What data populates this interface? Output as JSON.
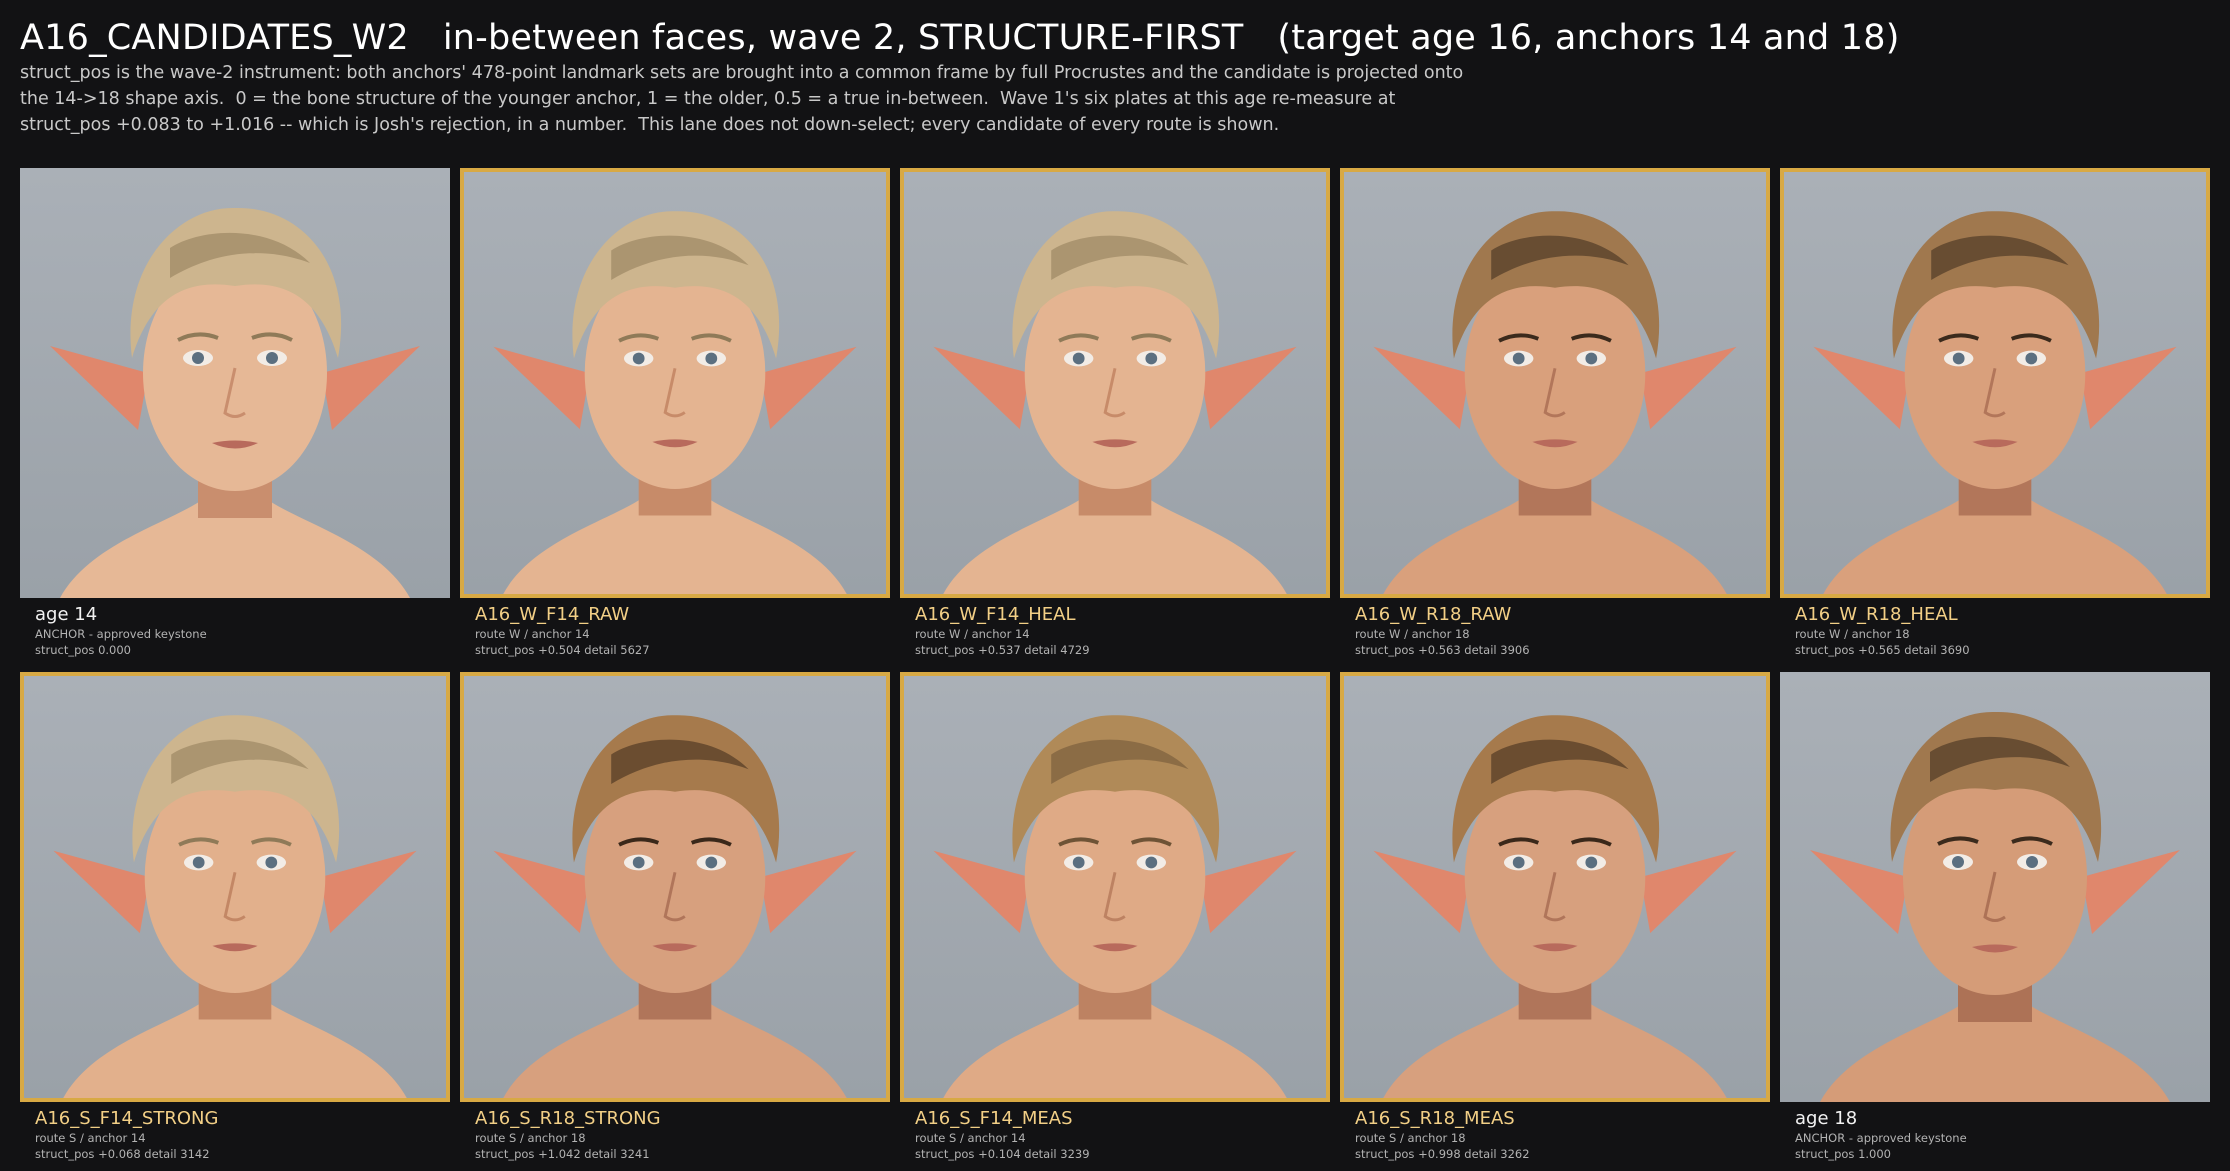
{
  "header": {
    "title": "A16_CANDIDATES_W2   in-between faces, wave 2, STRUCTURE-FIRST   (target age 16, anchors 14 and 18)",
    "description": [
      "struct_pos is the wave-2 instrument: both anchors' 478-point landmark sets are brought into a common frame by full Procrustes and the candidate is projected onto",
      "the 14->18 shape axis.  0 = the bone structure of the younger anchor, 1 = the older, 0.5 = a true in-between.  Wave 1's six plates at this age re-measure at",
      "struct_pos +0.083 to +1.016 -- which is Josh's rejection, in a number.  This lane does not down-select; every candidate of every route is shown."
    ]
  },
  "colors": {
    "background": "#121214",
    "candidate_border": "#d8a944",
    "candidate_title": "#f2cf86",
    "anchor_title": "#f2f2f2",
    "caption_text": "#b3b3b3"
  },
  "cards": [
    {
      "title": "age 14",
      "line1": "ANCHOR - approved keystone",
      "line2": "struct_pos 0.000",
      "anchor": true,
      "hair": "#cdb58e",
      "hairDark": "#8f7a58",
      "skin": "#e6b896",
      "skinShade": "#c98e6e"
    },
    {
      "title": "A16_W_F14_RAW",
      "line1": "route W  /  anchor 14",
      "line2": "struct_pos +0.504   detail 5627",
      "anchor": false,
      "hair": "#cdb58e",
      "hairDark": "#8f7a58",
      "skin": "#e4b491",
      "skinShade": "#c78b69"
    },
    {
      "title": "A16_W_F14_HEAL",
      "line1": "route W  /  anchor 14",
      "line2": "struct_pos +0.537   detail 4729",
      "anchor": false,
      "hair": "#cdb58e",
      "hairDark": "#8f7a58",
      "skin": "#e4b491",
      "skinShade": "#c78b69"
    },
    {
      "title": "A16_W_R18_RAW",
      "line1": "route W  /  anchor 18",
      "line2": "struct_pos +0.563   detail 3906",
      "anchor": false,
      "hair": "#a0784e",
      "hairDark": "#3b2a1c",
      "skin": "#d9a07c",
      "skinShade": "#b2765a"
    },
    {
      "title": "A16_W_R18_HEAL",
      "line1": "route W  /  anchor 18",
      "line2": "struct_pos +0.565   detail 3690",
      "anchor": false,
      "hair": "#a0784e",
      "hairDark": "#3b2a1c",
      "skin": "#d9a07c",
      "skinShade": "#b2765a"
    },
    {
      "title": "A16_S_F14_STRONG",
      "line1": "route S  /  anchor 14",
      "line2": "struct_pos +0.068   detail 3142",
      "anchor": false,
      "hair": "#cdb58e",
      "hairDark": "#8f7a58",
      "skin": "#e2b08c",
      "skinShade": "#c38765"
    },
    {
      "title": "A16_S_R18_STRONG",
      "line1": "route S  /  anchor 18",
      "line2": "struct_pos +1.042   detail 3241",
      "anchor": false,
      "hair": "#a67a4c",
      "hairDark": "#3a281a",
      "skin": "#d7a07e",
      "skinShade": "#b0755a"
    },
    {
      "title": "A16_S_F14_MEAS",
      "line1": "route S  /  anchor 14",
      "line2": "struct_pos +0.104   detail 3239",
      "anchor": false,
      "hair": "#b08a58",
      "hairDark": "#6e5336",
      "skin": "#dfaa86",
      "skinShade": "#bd8262"
    },
    {
      "title": "A16_S_R18_MEAS",
      "line1": "route S  /  anchor 18",
      "line2": "struct_pos +0.998   detail 3262",
      "anchor": false,
      "hair": "#a67a4c",
      "hairDark": "#3a281a",
      "skin": "#d7a07e",
      "skinShade": "#b0755a"
    },
    {
      "title": "age 18",
      "line1": "ANCHOR - approved keystone",
      "line2": "struct_pos 1.000",
      "anchor": true,
      "hair": "#a0784e",
      "hairDark": "#3b2a1c",
      "skin": "#d59c78",
      "skinShade": "#ad7256"
    }
  ]
}
